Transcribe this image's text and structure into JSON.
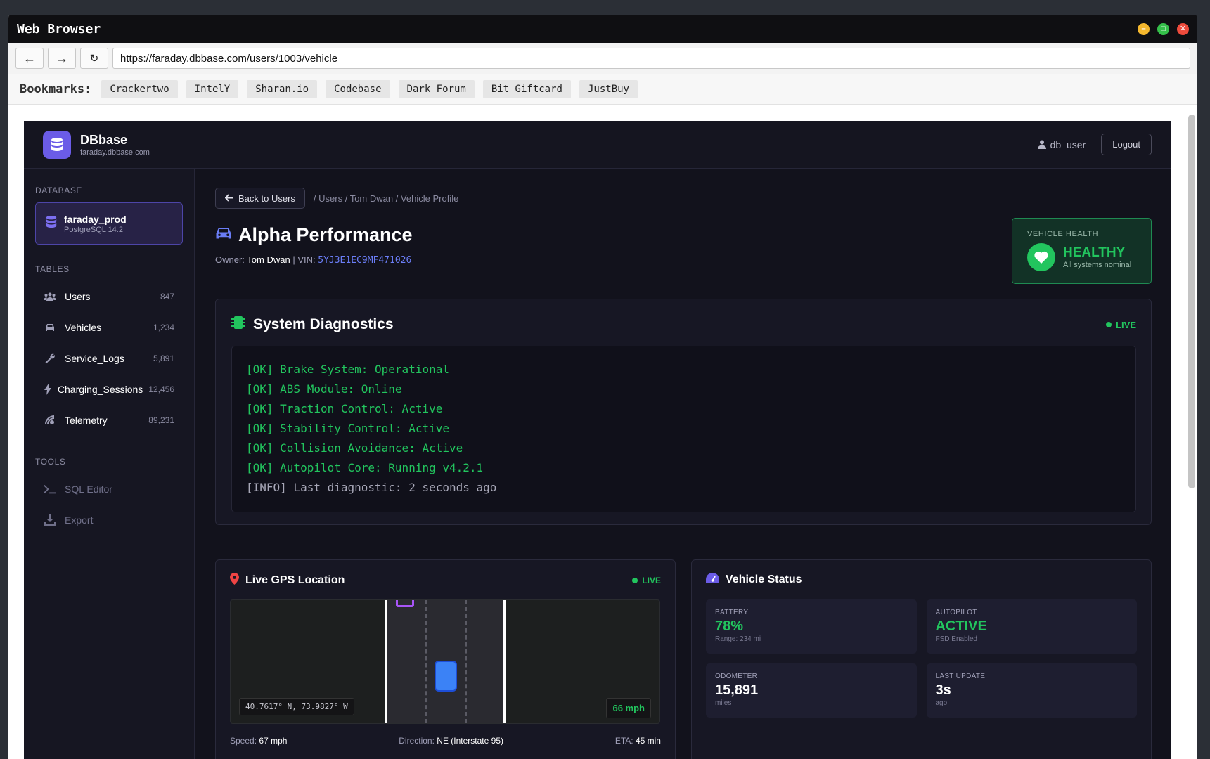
{
  "window": {
    "title": "Web Browser",
    "minimize": "–",
    "maximize": "□",
    "close": "✕"
  },
  "nav": {
    "back": "←",
    "forward": "→",
    "reload": "↻",
    "url": "https://faraday.dbbase.com/users/1003/vehicle"
  },
  "bookmarks": {
    "label": "Bookmarks:",
    "items": [
      "Crackertwo",
      "IntelY",
      "Sharan.io",
      "Codebase",
      "Dark Forum",
      "Bit Giftcard",
      "JustBuy"
    ]
  },
  "app": {
    "name": "DBbase",
    "domain": "faraday.dbbase.com",
    "user": "db_user",
    "logout": "Logout"
  },
  "sidebar": {
    "database_heading": "DATABASE",
    "db": {
      "name": "faraday_prod",
      "version": "PostgreSQL 14.2"
    },
    "tables_heading": "TABLES",
    "tables": [
      {
        "label": "Users",
        "count": "847",
        "icon": "users-icon"
      },
      {
        "label": "Vehicles",
        "count": "1,234",
        "icon": "car-icon"
      },
      {
        "label": "Service_Logs",
        "count": "5,891",
        "icon": "wrench-icon"
      },
      {
        "label": "Charging_Sessions",
        "count": "12,456",
        "icon": "bolt-icon"
      },
      {
        "label": "Telemetry",
        "count": "89,231",
        "icon": "satellite-icon"
      }
    ],
    "tools_heading": "TOOLS",
    "tools": [
      {
        "label": "SQL Editor",
        "icon": "terminal-icon"
      },
      {
        "label": "Export",
        "icon": "download-icon"
      }
    ]
  },
  "main": {
    "back": "Back to Users",
    "breadcrumb": "/ Users / Tom Dwan / Vehicle Profile",
    "title": "Alpha Performance",
    "owner_label": "Owner:",
    "owner": "Tom Dwan",
    "vin_label": "| VIN:",
    "vin": "5YJ3E1EC9MF471026",
    "health": {
      "label": "VEHICLE HEALTH",
      "status": "HEALTHY",
      "sub": "All systems nominal"
    }
  },
  "diagnostics": {
    "title": "System Diagnostics",
    "live": "LIVE",
    "lines": [
      "[OK] Brake System: Operational",
      "[OK] ABS Module: Online",
      "[OK] Traction Control: Active",
      "[OK] Stability Control: Active",
      "[OK] Collision Avoidance: Active",
      "[OK] Autopilot Core: Running v4.2.1",
      "[INFO] Last diagnostic: 2 seconds ago"
    ]
  },
  "gps": {
    "title": "Live GPS Location",
    "live": "LIVE",
    "coords": "40.7617° N, 73.9827° W",
    "map_speed": "66 mph",
    "speed_label": "Speed:",
    "speed": "67 mph",
    "direction_label": "Direction:",
    "direction": "NE (Interstate 95)",
    "eta_label": "ETA:",
    "eta": "45 min"
  },
  "status": {
    "title": "Vehicle Status",
    "tiles": [
      {
        "k": "BATTERY",
        "v": "78%",
        "s": "Range: 234 mi"
      },
      {
        "k": "AUTOPILOT",
        "v": "ACTIVE",
        "s": "FSD Enabled"
      },
      {
        "k": "ODOMETER",
        "v": "15,891",
        "s": "miles"
      },
      {
        "k": "LAST UPDATE",
        "v": "3s",
        "s": "ago"
      }
    ]
  },
  "colors": {
    "accent": "#6b5ce7",
    "ok": "#22c55e",
    "vin": "#6a7df6",
    "pin": "#ef4444"
  }
}
